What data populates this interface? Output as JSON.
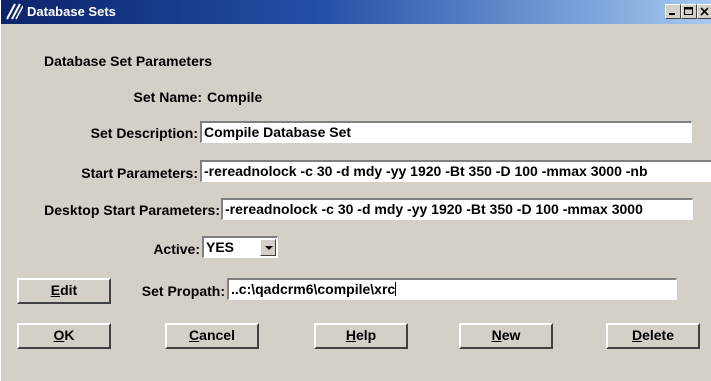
{
  "window": {
    "title": "Database Sets",
    "controls": [
      "minimize-icon",
      "maximize-icon",
      "close-icon"
    ],
    "titlebar_color": "#0a246a"
  },
  "form": {
    "section_title": "Database Set Parameters",
    "set_name_label": "Set Name:",
    "set_name_value": "Compile",
    "set_description_label": "Set Description:",
    "set_description_value": "Compile Database Set",
    "start_parameters_label": "Start Parameters:",
    "start_parameters_value": "-rereadnolock -c 30 -d mdy -yy 1920 -Bt 350 -D 100 -mmax 3000 -nb",
    "desktop_start_parameters_label": "Desktop Start Parameters:",
    "desktop_start_parameters_value": "-rereadnolock -c 30 -d mdy -yy 1920 -Bt 350 -D 100 -mmax 3000",
    "active_label": "Active:",
    "active_value": "YES",
    "set_propath_label": "Set Propath:",
    "set_propath_value": "..c:\\qadcrm6\\compile\\xrc"
  },
  "buttons": {
    "edit": {
      "mnemonic": "E",
      "rest": "dit"
    },
    "ok": {
      "mnemonic": "O",
      "rest": "K"
    },
    "cancel": {
      "mnemonic": "C",
      "rest": "ancel"
    },
    "help": {
      "mnemonic": "H",
      "rest": "elp"
    },
    "new": {
      "mnemonic": "N",
      "rest": "ew"
    },
    "delete": {
      "mnemonic": "D",
      "rest": "elete"
    }
  }
}
